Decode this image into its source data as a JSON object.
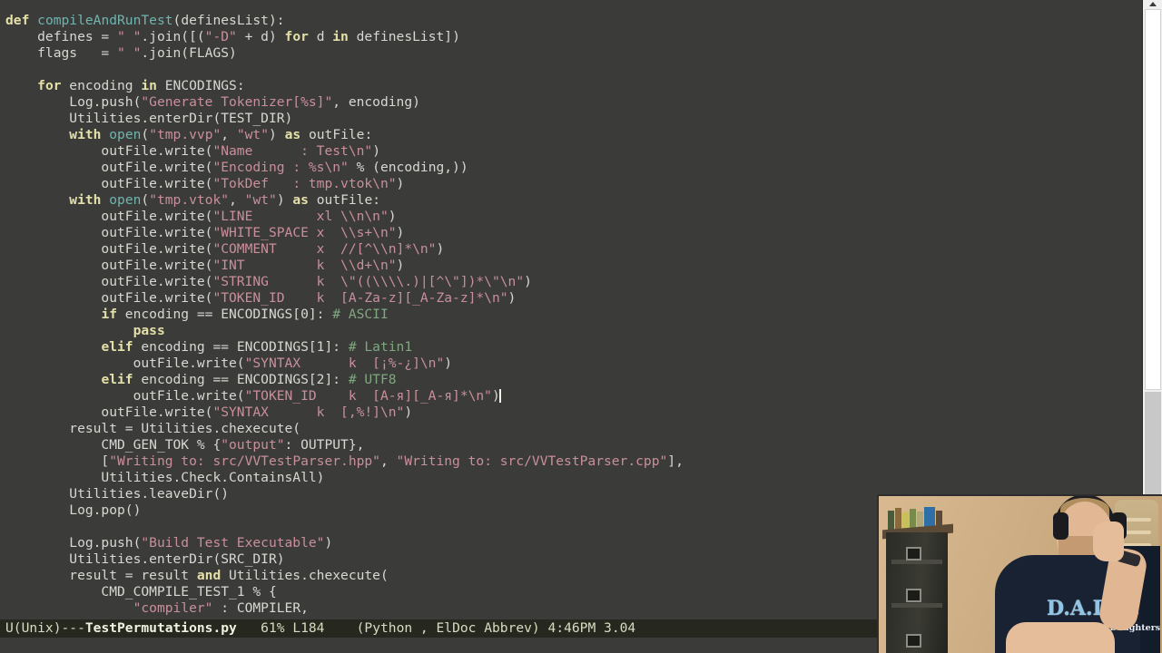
{
  "window": {
    "app": "Emacs",
    "buffer_name": "TestPermutations.py"
  },
  "editor": {
    "lines": [
      [
        {
          "t": "def ",
          "c": "kw"
        },
        {
          "t": "compileAndRunTest",
          "c": "fn"
        },
        {
          "t": "(definesList):",
          "c": "pl"
        }
      ],
      [
        {
          "t": "    defines = ",
          "c": "pl"
        },
        {
          "t": "\" \"",
          "c": "str"
        },
        {
          "t": ".join([(",
          "c": "pl"
        },
        {
          "t": "\"-D\"",
          "c": "str"
        },
        {
          "t": " + d) ",
          "c": "pl"
        },
        {
          "t": "for",
          "c": "kw"
        },
        {
          "t": " d ",
          "c": "pl"
        },
        {
          "t": "in",
          "c": "kw"
        },
        {
          "t": " definesList])",
          "c": "pl"
        }
      ],
      [
        {
          "t": "    flags   = ",
          "c": "pl"
        },
        {
          "t": "\" \"",
          "c": "str"
        },
        {
          "t": ".join(FLAGS)",
          "c": "pl"
        }
      ],
      [],
      [
        {
          "t": "    ",
          "c": "pl"
        },
        {
          "t": "for",
          "c": "kw"
        },
        {
          "t": " encoding ",
          "c": "pl"
        },
        {
          "t": "in",
          "c": "kw"
        },
        {
          "t": " ENCODINGS:",
          "c": "pl"
        }
      ],
      [
        {
          "t": "        Log.push(",
          "c": "pl"
        },
        {
          "t": "\"Generate Tokenizer[%s]\"",
          "c": "str"
        },
        {
          "t": ", encoding)",
          "c": "pl"
        }
      ],
      [
        {
          "t": "        Utilities.enterDir(TEST_DIR)",
          "c": "pl"
        }
      ],
      [
        {
          "t": "        ",
          "c": "pl"
        },
        {
          "t": "with",
          "c": "kw"
        },
        {
          "t": " ",
          "c": "pl"
        },
        {
          "t": "open",
          "c": "fn"
        },
        {
          "t": "(",
          "c": "pl"
        },
        {
          "t": "\"tmp.vvp\"",
          "c": "str"
        },
        {
          "t": ", ",
          "c": "pl"
        },
        {
          "t": "\"wt\"",
          "c": "str"
        },
        {
          "t": ") ",
          "c": "pl"
        },
        {
          "t": "as",
          "c": "kw"
        },
        {
          "t": " outFile:",
          "c": "pl"
        }
      ],
      [
        {
          "t": "            outFile.write(",
          "c": "pl"
        },
        {
          "t": "\"Name      : Test\\n\"",
          "c": "str"
        },
        {
          "t": ")",
          "c": "pl"
        }
      ],
      [
        {
          "t": "            outFile.write(",
          "c": "pl"
        },
        {
          "t": "\"Encoding : %s\\n\"",
          "c": "str"
        },
        {
          "t": " % (encoding,))",
          "c": "pl"
        }
      ],
      [
        {
          "t": "            outFile.write(",
          "c": "pl"
        },
        {
          "t": "\"TokDef   : tmp.vtok\\n\"",
          "c": "str"
        },
        {
          "t": ")",
          "c": "pl"
        }
      ],
      [
        {
          "t": "        ",
          "c": "pl"
        },
        {
          "t": "with",
          "c": "kw"
        },
        {
          "t": " ",
          "c": "pl"
        },
        {
          "t": "open",
          "c": "fn"
        },
        {
          "t": "(",
          "c": "pl"
        },
        {
          "t": "\"tmp.vtok\"",
          "c": "str"
        },
        {
          "t": ", ",
          "c": "pl"
        },
        {
          "t": "\"wt\"",
          "c": "str"
        },
        {
          "t": ") ",
          "c": "pl"
        },
        {
          "t": "as",
          "c": "kw"
        },
        {
          "t": " outFile:",
          "c": "pl"
        }
      ],
      [
        {
          "t": "            outFile.write(",
          "c": "pl"
        },
        {
          "t": "\"LINE        xl \\\\n\\n\"",
          "c": "str"
        },
        {
          "t": ")",
          "c": "pl"
        }
      ],
      [
        {
          "t": "            outFile.write(",
          "c": "pl"
        },
        {
          "t": "\"WHITE_SPACE x  \\\\s+\\n\"",
          "c": "str"
        },
        {
          "t": ")",
          "c": "pl"
        }
      ],
      [
        {
          "t": "            outFile.write(",
          "c": "pl"
        },
        {
          "t": "\"COMMENT     x  //[^\\\\n]*\\n\"",
          "c": "str"
        },
        {
          "t": ")",
          "c": "pl"
        }
      ],
      [
        {
          "t": "            outFile.write(",
          "c": "pl"
        },
        {
          "t": "\"INT         k  \\\\d+\\n\"",
          "c": "str"
        },
        {
          "t": ")",
          "c": "pl"
        }
      ],
      [
        {
          "t": "            outFile.write(",
          "c": "pl"
        },
        {
          "t": "\"STRING      k  \\\"((\\\\\\\\.)|[^\\\"])*\\\"\\n\"",
          "c": "str"
        },
        {
          "t": ")",
          "c": "pl"
        }
      ],
      [
        {
          "t": "            outFile.write(",
          "c": "pl"
        },
        {
          "t": "\"TOKEN_ID    k  [A-Za-z][_A-Za-z]*\\n\"",
          "c": "str"
        },
        {
          "t": ")",
          "c": "pl"
        }
      ],
      [
        {
          "t": "            ",
          "c": "pl"
        },
        {
          "t": "if",
          "c": "kw"
        },
        {
          "t": " encoding == ENCODINGS[0]: ",
          "c": "pl"
        },
        {
          "t": "# ASCII",
          "c": "cmt"
        }
      ],
      [
        {
          "t": "                ",
          "c": "pl"
        },
        {
          "t": "pass",
          "c": "kw"
        }
      ],
      [
        {
          "t": "            ",
          "c": "pl"
        },
        {
          "t": "elif",
          "c": "kw"
        },
        {
          "t": " encoding == ENCODINGS[1]: ",
          "c": "pl"
        },
        {
          "t": "# Latin1",
          "c": "cmt"
        }
      ],
      [
        {
          "t": "                outFile.write(",
          "c": "pl"
        },
        {
          "t": "\"SYNTAX      k  [¡%-¿]\\n\"",
          "c": "str"
        },
        {
          "t": ")",
          "c": "pl"
        }
      ],
      [
        {
          "t": "            ",
          "c": "pl"
        },
        {
          "t": "elif",
          "c": "kw"
        },
        {
          "t": " encoding == ENCODINGS[2]: ",
          "c": "pl"
        },
        {
          "t": "# UTF8",
          "c": "cmt"
        }
      ],
      [
        {
          "t": "                outFile.write(",
          "c": "pl"
        },
        {
          "t": "\"TOKEN_ID    k  [А-я][_А-я]*\\n\"",
          "c": "str"
        },
        {
          "t": ")",
          "c": "pl"
        },
        {
          "t": "|CURSOR|",
          "c": "cursor"
        }
      ],
      [
        {
          "t": "            outFile.write(",
          "c": "pl"
        },
        {
          "t": "\"SYNTAX      k  [,%!]\\n\"",
          "c": "str"
        },
        {
          "t": ")",
          "c": "pl"
        }
      ],
      [
        {
          "t": "        result = Utilities.chexecute(",
          "c": "pl"
        }
      ],
      [
        {
          "t": "            CMD_GEN_TOK % {",
          "c": "pl"
        },
        {
          "t": "\"output\"",
          "c": "str"
        },
        {
          "t": ": OUTPUT},",
          "c": "pl"
        }
      ],
      [
        {
          "t": "            [",
          "c": "pl"
        },
        {
          "t": "\"Writing to: src/VVTestParser.hpp\"",
          "c": "str"
        },
        {
          "t": ", ",
          "c": "pl"
        },
        {
          "t": "\"Writing to: src/VVTestParser.cpp\"",
          "c": "str"
        },
        {
          "t": "],",
          "c": "pl"
        }
      ],
      [
        {
          "t": "            Utilities.Check.ContainsAll)",
          "c": "pl"
        }
      ],
      [
        {
          "t": "        Utilities.leaveDir()",
          "c": "pl"
        }
      ],
      [
        {
          "t": "        Log.pop()",
          "c": "pl"
        }
      ],
      [],
      [
        {
          "t": "        Log.push(",
          "c": "pl"
        },
        {
          "t": "\"Build Test Executable\"",
          "c": "str"
        },
        {
          "t": ")",
          "c": "pl"
        }
      ],
      [
        {
          "t": "        Utilities.enterDir(SRC_DIR)",
          "c": "pl"
        }
      ],
      [
        {
          "t": "        result = result ",
          "c": "pl"
        },
        {
          "t": "and",
          "c": "kw"
        },
        {
          "t": " Utilities.chexecute(",
          "c": "pl"
        }
      ],
      [
        {
          "t": "            CMD_COMPILE_TEST_1 % {",
          "c": "pl"
        }
      ],
      [
        {
          "t": "                ",
          "c": "pl"
        },
        {
          "t": "\"compiler\"",
          "c": "str"
        },
        {
          "t": " : COMPILER,",
          "c": "pl"
        }
      ]
    ]
  },
  "modeline": {
    "coding": "U(Unix)---",
    "buffer": "TestPermutations.py",
    "position_percent": "61%",
    "line_number": "L184",
    "major_mode": "(Python , ElDoc Abbrev)",
    "time": "4:46PM",
    "load_average": "3.04",
    "spacer1": "   ",
    "spacer2": "    ",
    "spacer3": " ",
    "spacer4": " "
  },
  "scrollbar": {
    "arrow_icon": "scroll-up-arrow-icon"
  },
  "webcam": {
    "shirt_line1": "D.A.D.D.",
    "shirt_line2": "Dads Against Daughters Dating"
  },
  "colors": {
    "editor_background": "#3b3b39",
    "foreground": "#d8d8d2",
    "keyword": "#e5e0a8",
    "function": "#6fb5b0",
    "string": "#c98f9c",
    "comment": "#7fa87f",
    "modeline_background": "#26281f",
    "modeline_foreground": "#d8dcc0"
  }
}
